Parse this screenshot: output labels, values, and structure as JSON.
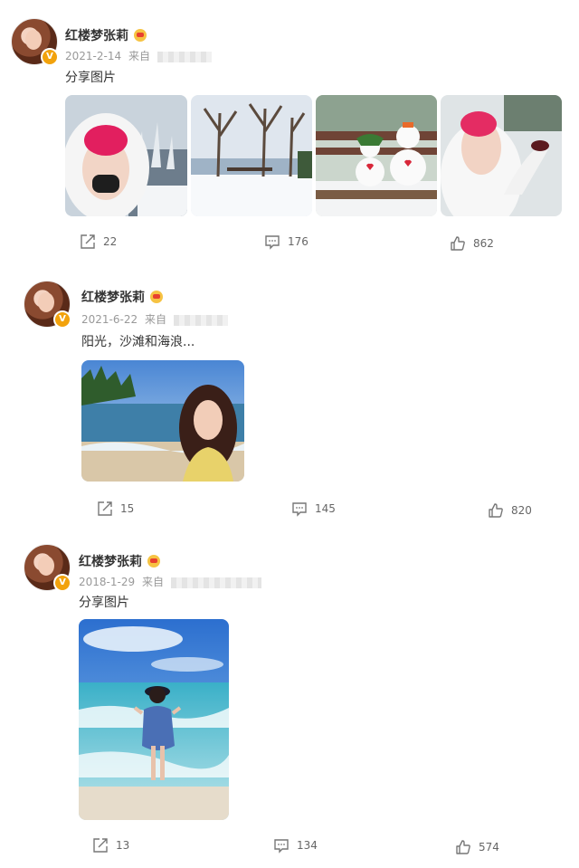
{
  "posts": [
    {
      "username": "红楼梦张莉",
      "date": "2021-2-14",
      "source_label": "来自",
      "text": "分享图片",
      "actions": {
        "share": "22",
        "comment": "176",
        "like": "862"
      }
    },
    {
      "username": "红楼梦张莉",
      "date": "2021-6-22",
      "source_label": "来自",
      "text": "阳光，沙滩和海浪...",
      "actions": {
        "share": "15",
        "comment": "145",
        "like": "820"
      }
    },
    {
      "username": "红楼梦张莉",
      "date": "2018-1-29",
      "source_label": "来自",
      "text": "分享图片",
      "actions": {
        "share": "13",
        "comment": "134",
        "like": "574"
      }
    }
  ],
  "badge_glyph": "V",
  "icons": [
    "share-icon",
    "comment-icon",
    "like-icon",
    "verified-badge-icon",
    "member-crown-icon"
  ],
  "colors": {
    "badge": "#f2a20c",
    "meta_text": "#999999",
    "body_text": "#333333"
  }
}
